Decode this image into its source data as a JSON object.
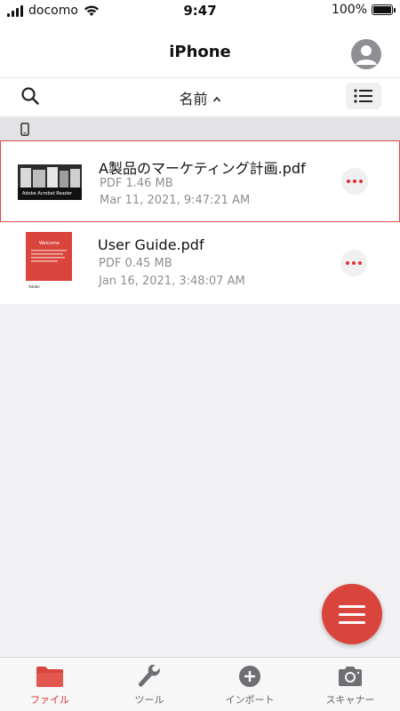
{
  "status_bar": {
    "carrier": "docomo",
    "time": "9:47",
    "battery": "100%"
  },
  "nav": {
    "title": "iPhone"
  },
  "toolbar": {
    "sort_label": "名前"
  },
  "files": [
    {
      "name": "A製品のマーケティング計画.pdf",
      "type_size": "PDF   1.46 MB",
      "date": "Mar 11, 2021, 9:47:21 AM",
      "selected": true
    },
    {
      "name": "User Guide.pdf",
      "type_size": "PDF   0.45 MB",
      "date": "Jan 16, 2021, 3:48:07 AM",
      "selected": false
    }
  ],
  "thumbnail_text": {
    "doc1_caption": "Adobe Acrobat Reader",
    "doc2_heading": "Welcome",
    "doc2_footer": "Adobe"
  },
  "tabs": [
    {
      "label": "ファイル",
      "icon": "folder-icon",
      "active": true
    },
    {
      "label": "ツール",
      "icon": "wrench-icon",
      "active": false
    },
    {
      "label": "インポート",
      "icon": "plus-circle-icon",
      "active": false
    },
    {
      "label": "スキャナー",
      "icon": "camera-icon",
      "active": false
    }
  ],
  "colors": {
    "accent": "#d9453c",
    "selection_border": "#e04b4b",
    "meta_text": "#8e8e93"
  }
}
